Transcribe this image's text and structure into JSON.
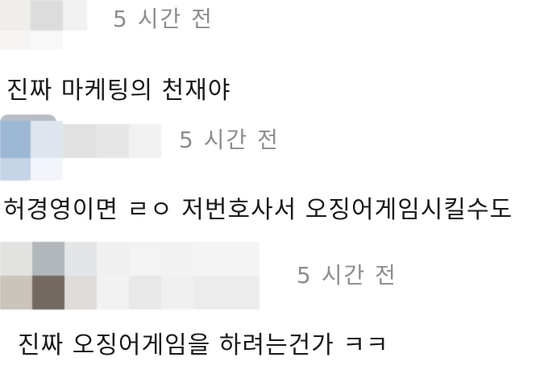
{
  "comments": [
    {
      "time": "5 시간 전",
      "text": "진짜 마케팅의 천재야"
    },
    {
      "time": "5 시간 전",
      "text": "허경영이면 ㄹㅇ 저번호사서 오징어게임시킬수도"
    },
    {
      "time": "5 시간 전",
      "text": "진짜 오징어게임을 하려는건가 ㅋㅋ"
    }
  ],
  "colors": {
    "timestamp": "#8d8d8d",
    "text": "#1a1a1a"
  }
}
